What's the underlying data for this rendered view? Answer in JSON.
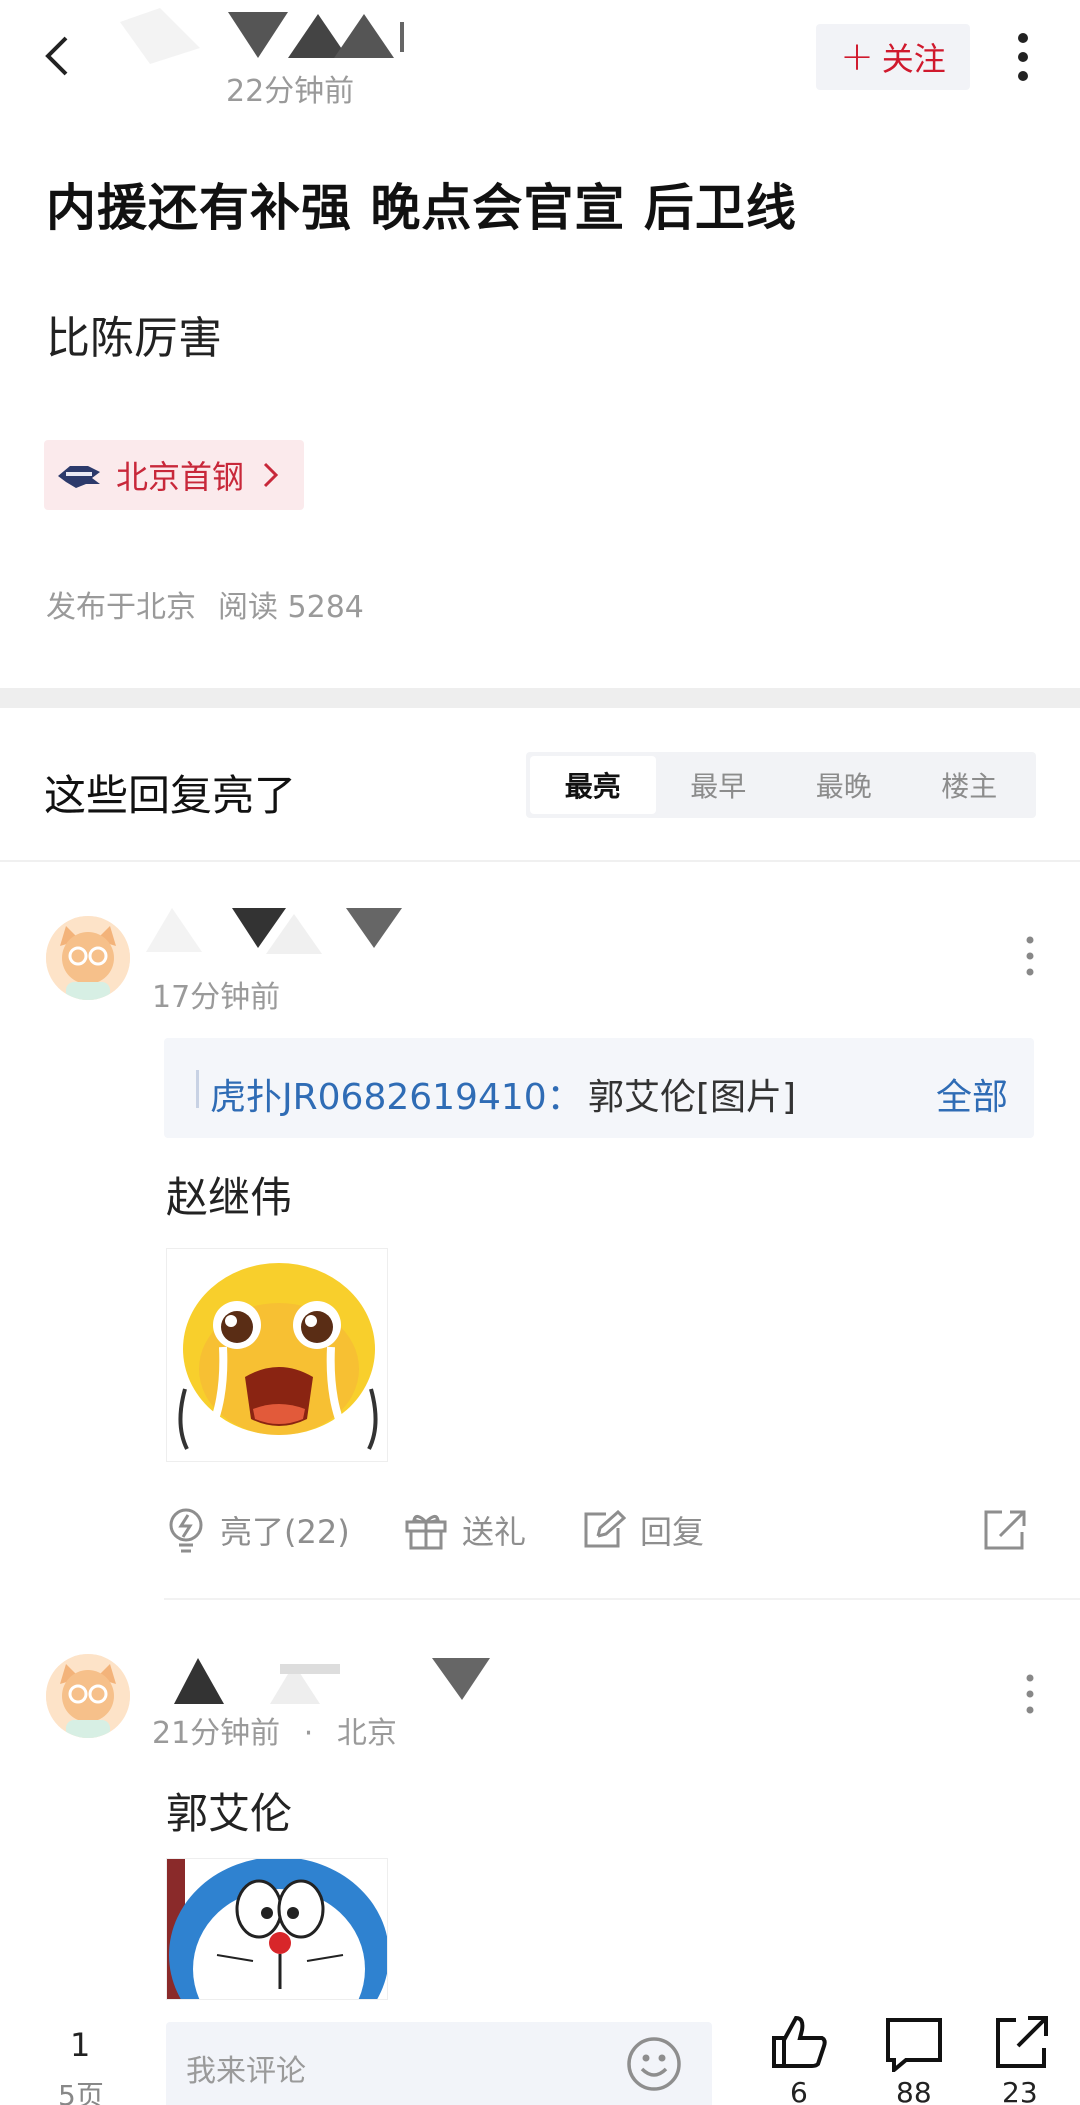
{
  "header": {
    "post_time": "22分钟前",
    "follow_label": "关注",
    "follow_plus": "+"
  },
  "post": {
    "title": "内援还有补强 晚点会官宣 后卫线",
    "body": "比陈厉害",
    "team_tag": "北京首钢",
    "location": "发布于北京",
    "reads": "阅读 5284"
  },
  "section": {
    "title": "这些回复亮了",
    "tabs": [
      {
        "label": "最亮",
        "active": true
      },
      {
        "label": "最早",
        "active": false
      },
      {
        "label": "最晚",
        "active": false
      },
      {
        "label": "楼主",
        "active": false
      }
    ]
  },
  "comments": [
    {
      "time": "17分钟前",
      "quote_user": "虎扑JR0682619410：",
      "quote_text": "郭艾伦[图片]",
      "quote_all": "全部",
      "text": "赵继伟",
      "sticker": "crying-emoji-sticker",
      "actions": {
        "light": "亮了(22)",
        "gift": "送礼",
        "reply": "回复"
      }
    },
    {
      "time": "21分钟前",
      "location": "北京",
      "separator": "·",
      "text": "郭艾伦",
      "sticker": "doraemon-sticker"
    }
  ],
  "bottom": {
    "page": "1",
    "page_total": "5页",
    "input_placeholder": "我来评论",
    "like_count": "6",
    "comment_count": "88",
    "share_count": "23"
  },
  "colors": {
    "accent_red": "#d0192d",
    "link_blue": "#2f6cb5"
  }
}
